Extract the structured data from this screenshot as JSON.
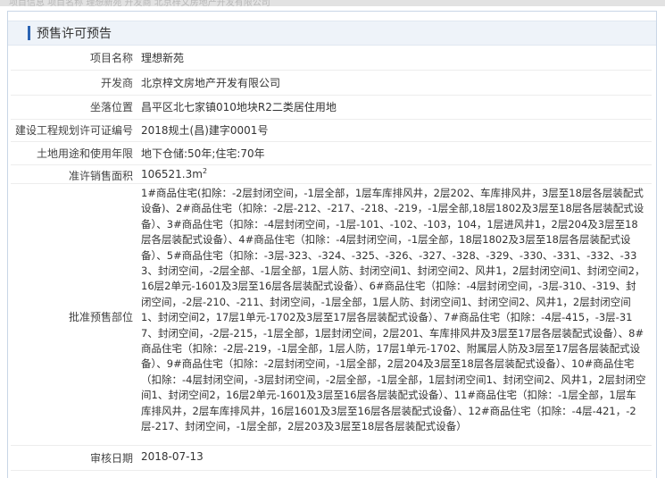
{
  "page": {
    "top_strip_text": "项目信息  项目名称  理想新苑  开发商  北京梓文房地产开发有限公司",
    "section_title": "预售许可预告"
  },
  "fields": [
    {
      "label": "项目名称",
      "value": "理想新苑"
    },
    {
      "label": "开发商",
      "value": "北京梓文房地产开发有限公司"
    },
    {
      "label": "坐落位置",
      "value": "昌平区北七家镇010地块R2二类居住用地"
    },
    {
      "label": "建设工程规划许可证编号",
      "value": "2018规土(昌)建字0001号"
    },
    {
      "label": "土地用途和使用年限",
      "value": "地下仓储:50年;住宅:70年"
    }
  ],
  "sales_area": {
    "label": "准许销售面积",
    "value": "106521.3m",
    "unit_sup": "2"
  },
  "sales_scope": {
    "label": "批准预售部位",
    "value": "1#商品住宅(扣除：-2层封闭空间，-1层全部，1层车库排风井，2层202、车库排风井，3层至18层各层装配式设备)、2#商品住宅（扣除：-2层-212、-217、-218、-219，-1层全部,18层1802及3层至18层各层装配式设备）、3#商品住宅（扣除：-4层封闭空间，-1层-101、-102、-103，104，1层进风井1，2层204及3层至18层各层装配式设备）、4#商品住宅（扣除：-4层封闭空间，-1层全部，18层1802及3层至18层各层装配式设备）、5#商品住宅（扣除：-3层-323、-324、-325、-326、-327、-328、-329、-330、-331、-332、-333、封闭空间，-2层全部、-1层全部，1层人防、封闭空间1、封闭空间2、风井1，2层封闭空间1、封闭空间2，16层2单元-1601及3层至16层各层装配式设备）、6#商品住宅（扣除：-4层封闭空间，-3层-310、-319、封闭空间，-2层-210、-211、封闭空间，-1层全部，1层人防、封闭空间1、封闭空间2、风井1，2层封闭空间1、封闭空间2，17层1单元-1702及3层至17层各层装配式设备）、7#商品住宅（扣除：-4层-415，-3层-317、封闭空间，-2层-215，-1层全部，1层封闭空间，2层201、车库排风井及3层至17层各层装配式设备）、8#商品住宅（扣除：-2层-219，-1层全部，1层人防，17层1单元-1702、附属层人防及3层至17层各层装配式设备）、9#商品住宅（扣除：-2层封闭空间，-1层全部，2层204及3层至18层各层装配式设备）、10#商品住宅（扣除：-4层封闭空间，-3层封闭空间，-2层全部，-1层全部，1层封闭空间1、封闭空间2、风井1，2层封闭空间1、封闭空间2，16层2单元-1601及3层至16层各层装配式设备）、11#商品住宅（扣除：-1层全部，1层车库排风井，2层车库排风井，16层1601及3层至16层各层装配式设备）、12#商品住宅（扣除：-4层-421，-2层-217、封闭空间，-1层全部，2层203及3层至18层各层装配式设备）"
  },
  "audit_date": {
    "label": "审核日期",
    "value": "2018-07-13"
  }
}
